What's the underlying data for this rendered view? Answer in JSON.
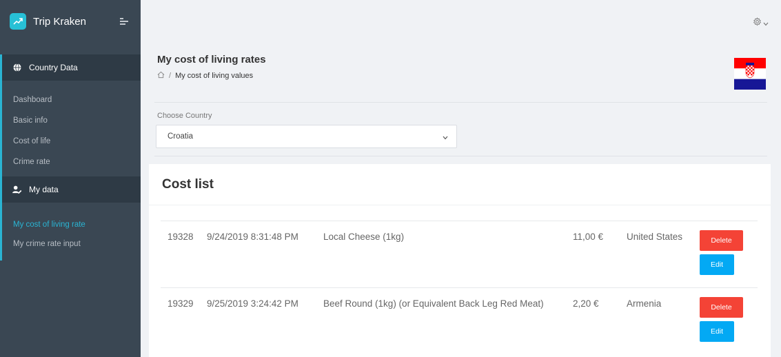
{
  "sidebar": {
    "brand": "Trip Kraken",
    "sections": [
      {
        "title": "Country Data",
        "icon": "globe-icon",
        "items": [
          {
            "label": "Dashboard",
            "active": false
          },
          {
            "label": "Basic info",
            "active": false
          },
          {
            "label": "Cost of life",
            "active": false
          },
          {
            "label": "Crime rate",
            "active": false
          }
        ]
      },
      {
        "title": "My data",
        "icon": "user-edit-icon",
        "items": [
          {
            "label": "My cost of living rate",
            "active": true
          },
          {
            "label": "My crime rate input",
            "active": false
          }
        ]
      }
    ]
  },
  "header": {
    "title": "My cost of living rates",
    "breadcrumb_separator": "/",
    "breadcrumb_current": "My cost of living values",
    "settings_icon": "gear-icon"
  },
  "country_select": {
    "label": "Choose Country",
    "value": "Croatia"
  },
  "cost_list": {
    "title": "Cost list",
    "rows": [
      {
        "id": "19328",
        "date": "9/24/2019 8:31:48 PM",
        "item": "Local Cheese (1kg)",
        "price": "11,00 €",
        "country": "United States",
        "delete_label": "Delete",
        "edit_label": "Edit"
      },
      {
        "id": "19329",
        "date": "9/25/2019 3:24:42 PM",
        "item": "Beef Round (1kg) (or Equivalent Back Leg Red Meat)",
        "price": "2,20 €",
        "country": "Armenia",
        "delete_label": "Delete",
        "edit_label": "Edit"
      }
    ]
  },
  "colors": {
    "accent": "#2ab4d3",
    "sidebar_bg": "#3a4753",
    "delete": "#f44336",
    "edit": "#03a9f4"
  }
}
